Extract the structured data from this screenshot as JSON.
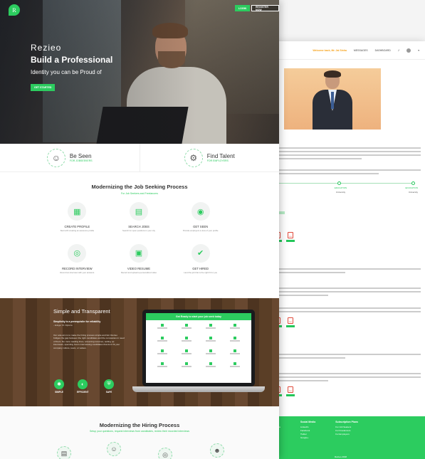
{
  "hero": {
    "logo_letter": "R",
    "login_label": "LOGIN",
    "register_label": "REGISTER NOW",
    "brand": "Rezieo",
    "headline": "Build a Professional",
    "subheadline": "Identity you can be Proud of",
    "cta_label": "GET STARTED"
  },
  "cta": [
    {
      "title": "Be Seen",
      "sub": "FOR JOBSEEKERS",
      "icon": "☺"
    },
    {
      "title": "Find Talent",
      "sub": "FOR EMPLOYERS",
      "icon": "⚙"
    }
  ],
  "process": {
    "title": "Modernizing the Job Seeking Process",
    "subtitle": "For Job Seekers and Freelancers",
    "steps": [
      {
        "label": "CREATE PROFILE",
        "desc": "Start with creating an awesome profile",
        "icon": "▦"
      },
      {
        "label": "SEARCH JOBS",
        "desc": "Search for open positions in your city",
        "icon": "▤"
      },
      {
        "label": "GET SEEN",
        "desc": "Provide employers a view of your profile",
        "icon": "◉"
      },
      {
        "label": "RECORD INTERVIEW",
        "desc": "Record an interview with your answers",
        "icon": "◎"
      },
      {
        "label": "VIDEO RESUME",
        "desc": "Record and upload a personalized video",
        "icon": "▣"
      },
      {
        "label": "GET HIRED",
        "desc": "Land the job that is the right fit for you",
        "icon": "✔"
      }
    ]
  },
  "simple": {
    "title": "Simple and Transparent",
    "sub1": "Simplicity is a prerequisite for reliability",
    "sub2": "- Edsger W. Dijkstra",
    "para": "Our sole aim is to make the hiring process simple and fair. Rezieo bridges the gap between the right candidates and the companies in need of them. No more reading lines, screening resumes, setting up interviews, spending hours interviewing candidates that don't fit your company culture, team, or values.",
    "features": [
      {
        "label": "SIMPLE",
        "icon": "✱"
      },
      {
        "label": "EFFICIENT",
        "icon": "◐"
      },
      {
        "label": "SAFE",
        "icon": "⛨"
      }
    ],
    "screen_title": "Get Ready to start your job seek today"
  },
  "hiring": {
    "title": "Modernizing the Hiring Process",
    "subtitle": "Setup your questions, request interviews from candidates, review their recorded interviews"
  },
  "profile_page": {
    "nav_highlight": "Welcome back, Mr. Jai Sinha",
    "nav_items": [
      "MESSAGES",
      "DASHBOARD"
    ],
    "about_heading": "is",
    "summary_heading": "mmary",
    "docs_heading": "Documents",
    "footer": {
      "col1_title": "Legal Terms",
      "col1_items": [
        "Terms & Conditions",
        "Privacy Policy"
      ],
      "col2_title": "Social Media",
      "col2_items": [
        "LinkedIn",
        "Facebook",
        "Twitter",
        "Google+"
      ],
      "col3_title": "Subscription Plans",
      "col3_items": [
        "For Job Seekers",
        "For Freelancers",
        "For Employers"
      ],
      "copyright": "Rezieo 2018"
    }
  }
}
